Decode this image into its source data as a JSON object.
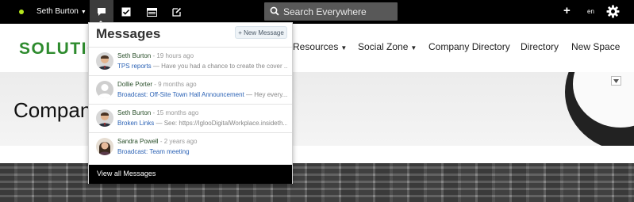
{
  "topbar": {
    "user_name": "Seth Burton",
    "search_placeholder": "Search Everywhere",
    "language": "en",
    "icons": [
      "messages-icon",
      "tasks-icon",
      "inbox-icon",
      "edit-icon",
      "search-icon",
      "plus-icon",
      "gear-icon"
    ],
    "status_color": "#b5e61d"
  },
  "header": {
    "logo_text": "SOLUTIO",
    "nav": [
      {
        "label": "Resources",
        "dropdown": true
      },
      {
        "label": "Social Zone",
        "dropdown": true
      },
      {
        "label": "Company Directory",
        "dropdown": false
      },
      {
        "label": "Directory",
        "dropdown": false
      },
      {
        "label": "New Space",
        "dropdown": false
      }
    ]
  },
  "hero": {
    "title": "Company"
  },
  "messages": {
    "title": "Messages",
    "new_button": "+ New Message",
    "items": [
      {
        "sender": "Seth Burton",
        "time": " - 19 hours ago",
        "subject": "TPS reports",
        "preview": " — Have you had a chance to create the cover ...",
        "avatar": "male"
      },
      {
        "sender": "Dollie Porter",
        "time": " - 9 months ago",
        "subject": "Broadcast: Off-Site Town Hall Announcement",
        "preview": " — Hey every...",
        "avatar": "placeholder"
      },
      {
        "sender": "Seth Burton",
        "time": " - 15 months ago",
        "subject": "Broken Links",
        "preview": " — See: https://IglooDigitalWorkplace.insideth...",
        "avatar": "male"
      },
      {
        "sender": "Sandra Powell",
        "time": " - 2 years ago",
        "subject": "Broadcast: Team meeting",
        "preview": "",
        "avatar": "female"
      }
    ],
    "footer": "View all Messages"
  },
  "colors": {
    "brand_green": "#2e8b2e",
    "link_blue": "#2b62b5",
    "topbar_bg": "#000000"
  }
}
